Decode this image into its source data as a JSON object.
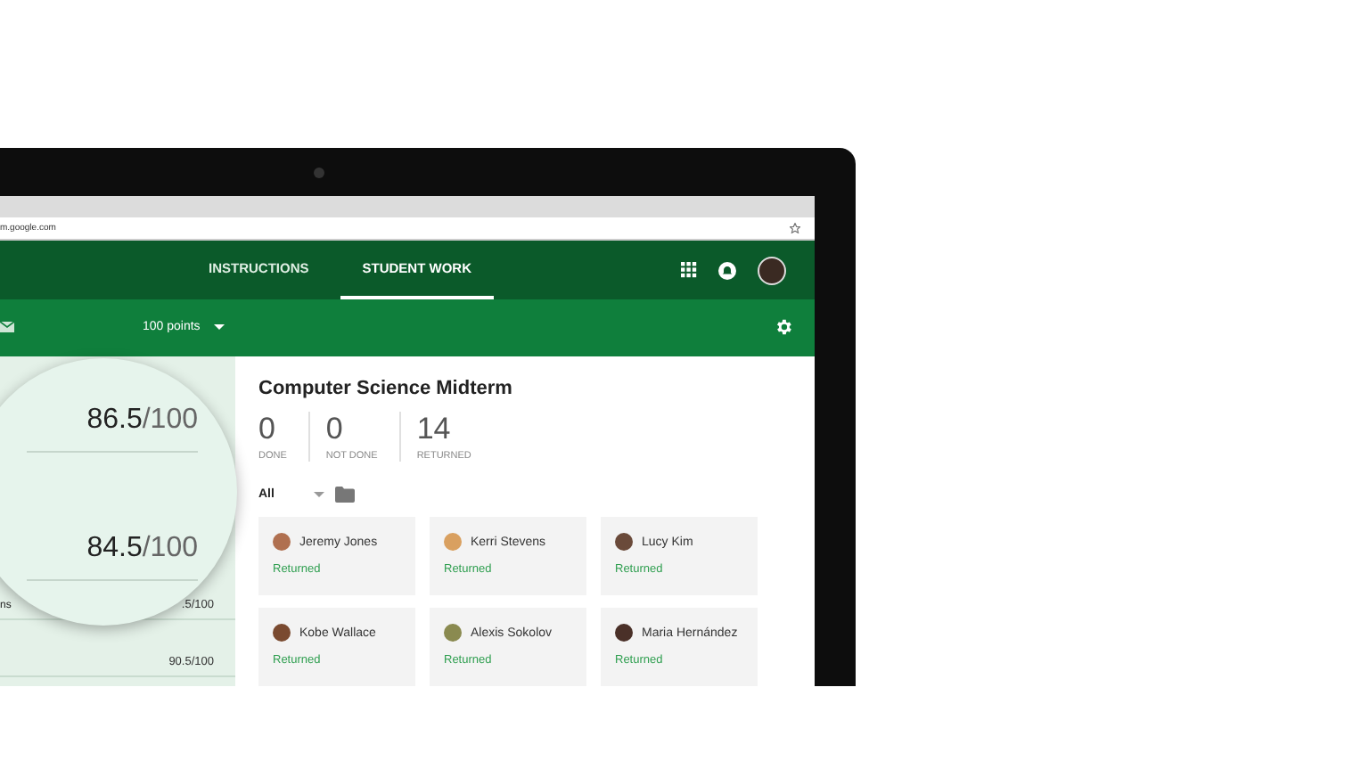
{
  "browser": {
    "address": "m.google.com"
  },
  "header": {
    "tabs": [
      {
        "label": "INSTRUCTIONS",
        "selected": false
      },
      {
        "label": "STUDENT WORK",
        "selected": true
      }
    ]
  },
  "toolbar": {
    "points": "100 points"
  },
  "grades_panel": {
    "rows": [
      {
        "name": "ns",
        "grade": ".5/100"
      },
      {
        "name": "",
        "grade": "90.5/100"
      }
    ]
  },
  "magnifier": {
    "grades": [
      {
        "score": "86.5",
        "out_of": "/100"
      },
      {
        "score": "84.5",
        "out_of": "/100"
      }
    ]
  },
  "assignment": {
    "title": "Computer Science Midterm",
    "stats": [
      {
        "value": "0",
        "label": "DONE"
      },
      {
        "value": "0",
        "label": "NOT DONE"
      },
      {
        "value": "14",
        "label": "RETURNED"
      }
    ],
    "filter": "All",
    "students": [
      {
        "name": "Jeremy Jones",
        "status": "Returned",
        "color": "#b07050"
      },
      {
        "name": "Kerri Stevens",
        "status": "Returned",
        "color": "#d9a060"
      },
      {
        "name": "Lucy Kim",
        "status": "Returned",
        "color": "#6a4a3a"
      },
      {
        "name": "Kobe Wallace",
        "status": "Returned",
        "color": "#7a4a30"
      },
      {
        "name": "Alexis Sokolov",
        "status": "Returned",
        "color": "#8a8a50"
      },
      {
        "name": "Maria Hernández",
        "status": "Returned",
        "color": "#4a3028"
      }
    ]
  }
}
